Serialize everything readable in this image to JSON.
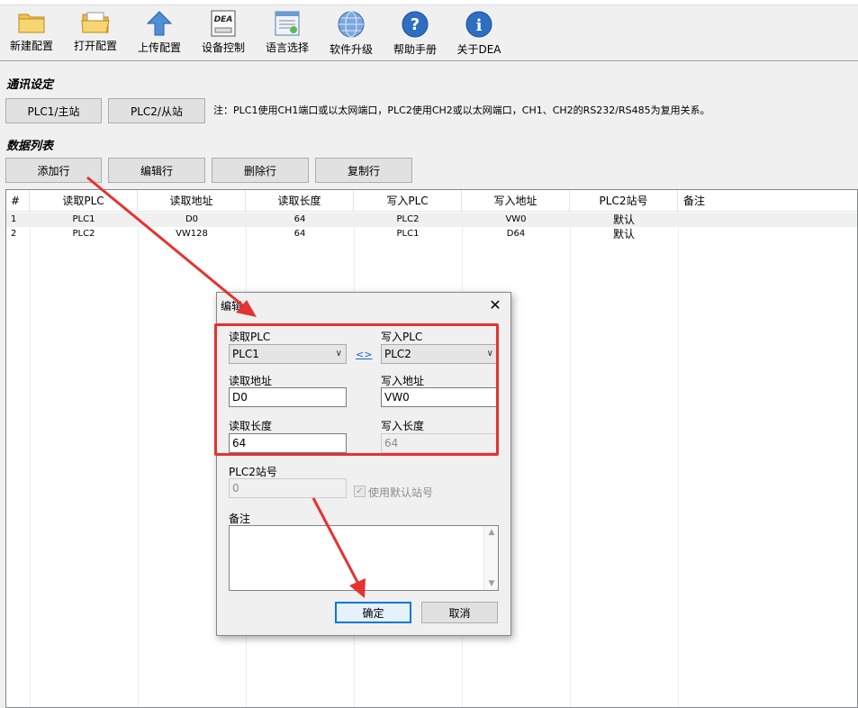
{
  "toolbar": {
    "items": [
      {
        "label": "新建配置",
        "icon": "folder-icon"
      },
      {
        "label": "打开配置",
        "icon": "open-folder-icon"
      },
      {
        "label": "上传配置",
        "icon": "upload-arrow-icon"
      },
      {
        "label": "设备控制",
        "icon": "dea-device-icon"
      },
      {
        "label": "语言选择",
        "icon": "language-window-icon"
      },
      {
        "label": "软件升级",
        "icon": "globe-icon"
      },
      {
        "label": "帮助手册",
        "icon": "help-icon"
      },
      {
        "label": "关于DEA",
        "icon": "info-icon"
      }
    ]
  },
  "comm": {
    "title": "通讯设定",
    "plc1_button": "PLC1/主站",
    "plc2_button": "PLC2/从站",
    "note": "注：PLC1使用CH1端口或以太网端口，PLC2使用CH2或以太网端口，CH1、CH2的RS232/RS485为复用关系。"
  },
  "datalist": {
    "title": "数据列表",
    "add_button": "添加行",
    "edit_button": "编辑行",
    "delete_button": "删除行",
    "copy_button": "复制行"
  },
  "table": {
    "headers": [
      "#",
      "读取PLC",
      "读取地址",
      "读取长度",
      "写入PLC",
      "写入地址",
      "PLC2站号",
      "备注"
    ],
    "rows": [
      [
        "1",
        "PLC1",
        "D0",
        "64",
        "PLC2",
        "VW0",
        "默认",
        ""
      ],
      [
        "2",
        "PLC2",
        "VW128",
        "64",
        "PLC1",
        "D64",
        "默认",
        ""
      ]
    ]
  },
  "dialog": {
    "title": "编辑",
    "close_glyph": "✕",
    "read_plc_label": "读取PLC",
    "read_plc_value": "PLC1",
    "swap_label": "<>",
    "write_plc_label": "写入PLC",
    "write_plc_value": "PLC2",
    "read_addr_label": "读取地址",
    "read_addr_value": "D0",
    "write_addr_label": "写入地址",
    "write_addr_value": "VW0",
    "read_len_label": "读取长度",
    "read_len_value": "64",
    "write_len_label": "写入长度",
    "write_len_value": "64",
    "station_label": "PLC2站号",
    "station_value": "0",
    "use_default_label": "使用默认站号",
    "use_default_checked": true,
    "memo_label": "备注",
    "memo_value": "",
    "ok_button": "确定",
    "cancel_button": "取消"
  },
  "colors": {
    "annotation_red": "#e53232",
    "link_blue": "#1a5fd0",
    "focus_blue": "#0078d7"
  }
}
